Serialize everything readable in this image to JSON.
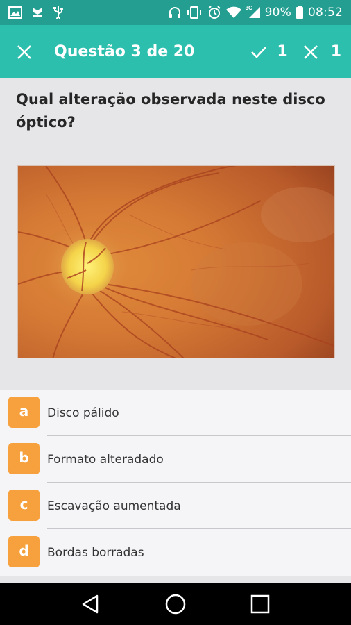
{
  "status_bar": {
    "battery": "90%",
    "time": "08:52",
    "network": "3G",
    "icons_left": [
      "image-icon",
      "notification-icon",
      "usb-icon"
    ],
    "icons_right": [
      "headphones-icon",
      "vibrate-icon",
      "alarm-icon",
      "wifi-icon",
      "signal-icon",
      "battery-icon"
    ]
  },
  "app_bar": {
    "title": "Questão 3 de 20",
    "correct_count": "1",
    "wrong_count": "1",
    "colors": {
      "app_bar": "#2dbfae",
      "status_bar": "#239e91"
    }
  },
  "question": {
    "text": "Qual alteração observada neste disco óptico?",
    "image_subject": "fundus-photo-optic-disc"
  },
  "options": [
    {
      "letter": "a",
      "label": "Disco pálido"
    },
    {
      "letter": "b",
      "label": "Formato alteradado"
    },
    {
      "letter": "c",
      "label": "Escavação aumentada"
    },
    {
      "letter": "d",
      "label": "Bordas borradas"
    }
  ],
  "option_badge_color": "#f6a13d",
  "nav_bar": {
    "icons": [
      "back-icon",
      "home-icon",
      "recents-icon"
    ]
  }
}
